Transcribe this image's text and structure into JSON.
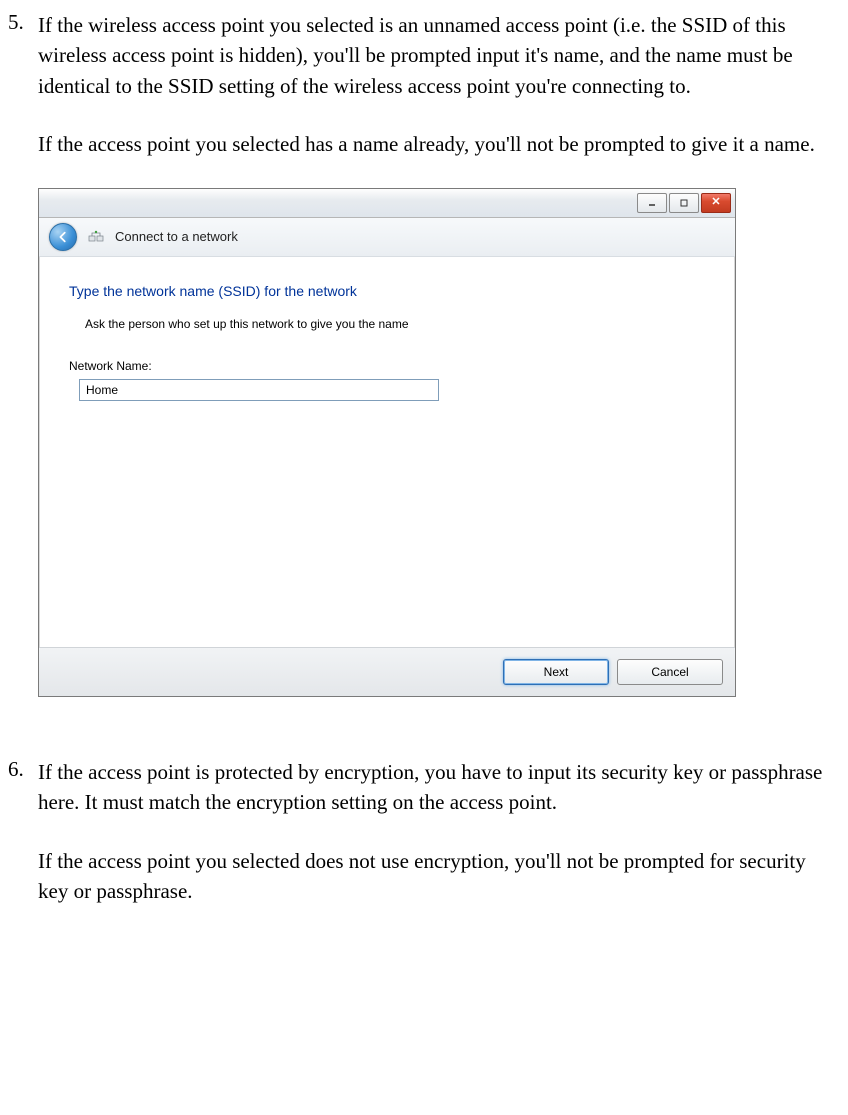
{
  "steps": {
    "five": {
      "num": "5.",
      "para1": "If the wireless access point you selected is an unnamed access point (i.e. the SSID of this wireless access point is hidden), you'll be prompted input it's name, and the name must be identical to the SSID setting of the wireless access point you're connecting to.",
      "para2": "If the access point you selected has a name already, you'll not be prompted to give it a name."
    },
    "six": {
      "num": "6.",
      "para1": "If the access point is protected by encryption, you have to input its security key or passphrase here. It must match the encryption setting on the access point.",
      "para2": "If the access point you selected does not use encryption, you'll not be prompted for security key or passphrase."
    }
  },
  "dialog": {
    "nav_title": "Connect to a network",
    "heading": "Type the network name (SSID) for the network",
    "subtext": "Ask the person who set up this network to give you the name",
    "field_label": "Network Name:",
    "field_value": "Home",
    "next_label": "Next",
    "cancel_label": "Cancel"
  }
}
